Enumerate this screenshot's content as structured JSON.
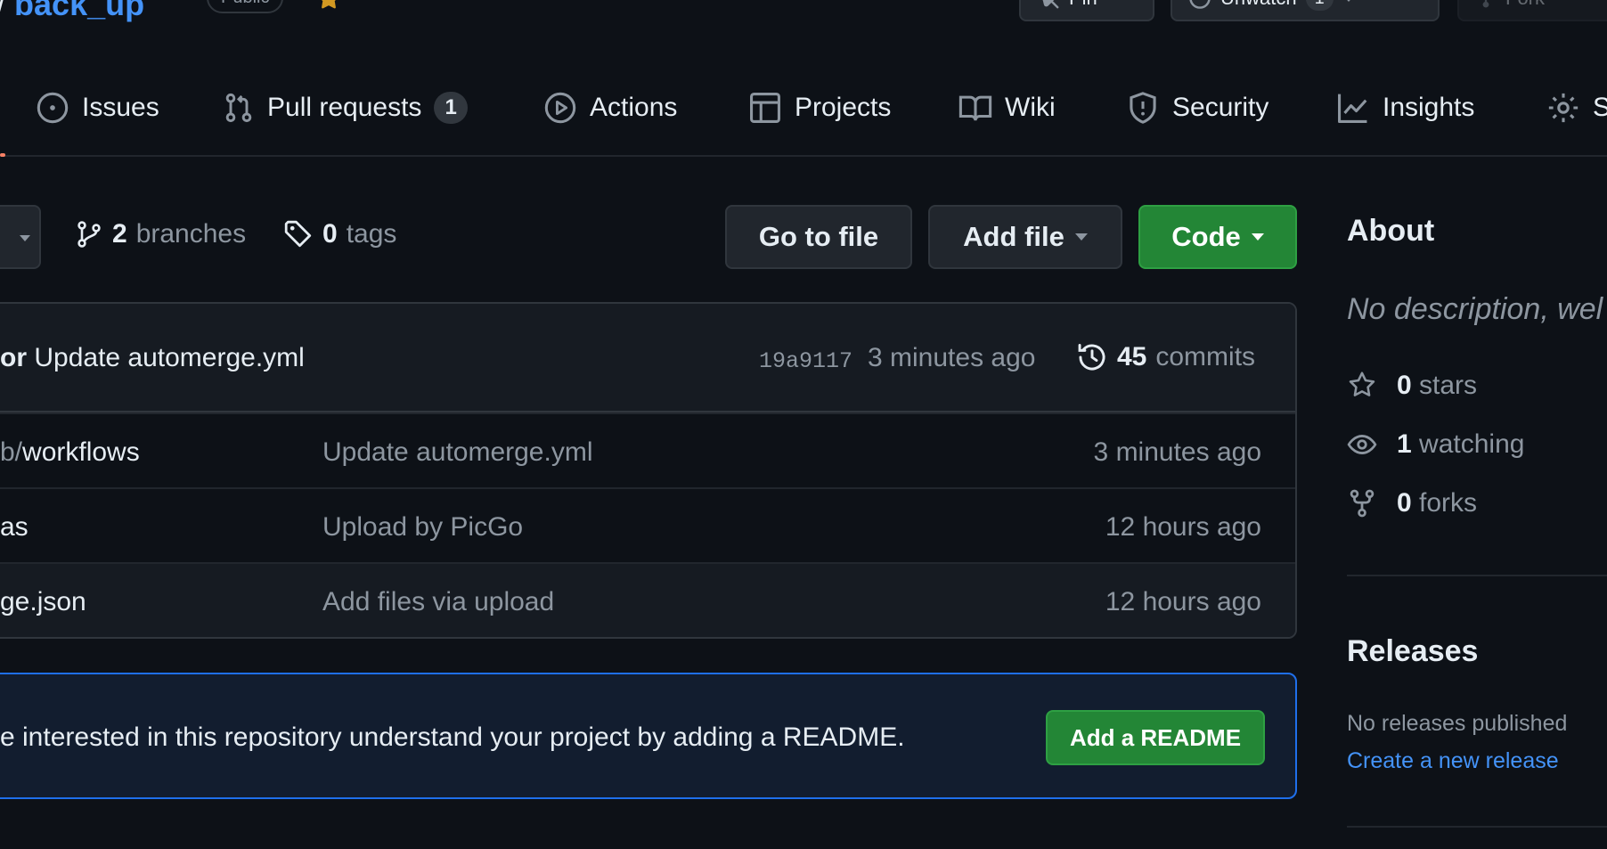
{
  "repo": {
    "owner_sep": "/",
    "name": "back_up",
    "visibility": "Public"
  },
  "header_actions": {
    "pin_label": "Pin",
    "unwatch_label": "Unwatch",
    "unwatch_count": "1",
    "fork_label": "Fork"
  },
  "nav": {
    "tabs": [
      {
        "label": "Issues",
        "icon": "issue-opened-icon"
      },
      {
        "label": "Pull requests",
        "icon": "git-pull-request-icon",
        "count": "1"
      },
      {
        "label": "Actions",
        "icon": "play-icon"
      },
      {
        "label": "Projects",
        "icon": "table-icon"
      },
      {
        "label": "Wiki",
        "icon": "book-icon"
      },
      {
        "label": "Security",
        "icon": "shield-icon"
      },
      {
        "label": "Insights",
        "icon": "graph-icon"
      },
      {
        "label": "S",
        "icon": "gear-icon"
      }
    ],
    "active_color": "#f78166"
  },
  "toolbar": {
    "branches_count": "2",
    "branches_label": "branches",
    "tags_count": "0",
    "tags_label": "tags",
    "go_to_file": "Go to file",
    "add_file": "Add file",
    "code": "Code"
  },
  "latest_commit": {
    "author_fragment": "or",
    "message": "Update automerge.yml",
    "sha": "19a9117",
    "time": "3 minutes ago",
    "commit_count": "45",
    "commit_label": "commits"
  },
  "files": [
    {
      "prefix": "b/",
      "name": "workflows",
      "message": "Update automerge.yml",
      "time": "3 minutes ago"
    },
    {
      "prefix": "",
      "name": "as",
      "message": "Upload by PicGo",
      "time": "12 hours ago"
    },
    {
      "prefix": "",
      "name": "ge.json",
      "message": "Add files via upload",
      "time": "12 hours ago"
    }
  ],
  "readme_banner": {
    "text": "e interested in this repository understand your project by adding a README.",
    "button": "Add a README"
  },
  "sidebar": {
    "about_title": "About",
    "description": "No description, wel",
    "stars_count": "0",
    "stars_label": "stars",
    "watching_count": "1",
    "watching_label": "watching",
    "forks_count": "0",
    "forks_label": "forks",
    "releases_title": "Releases",
    "releases_empty": "No releases published",
    "create_release": "Create a new release"
  },
  "colors": {
    "background": "#0d1117",
    "accent_link": "#4493f8",
    "primary_button": "#238636",
    "muted_text": "#8d96a0",
    "border": "#30363d"
  }
}
